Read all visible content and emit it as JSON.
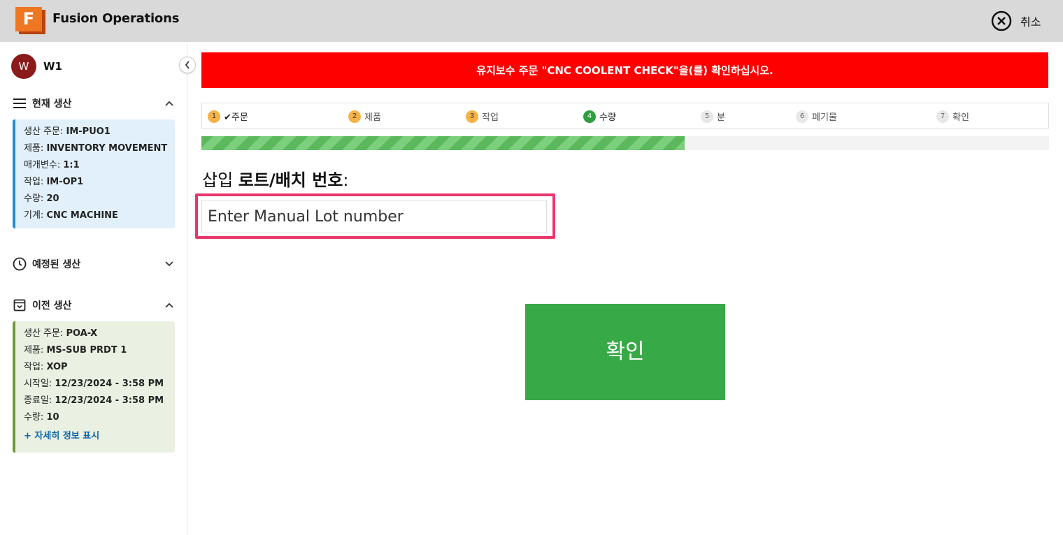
{
  "app": {
    "title": "Fusion Operations",
    "logo_letter": "F",
    "cancel_label": "취소"
  },
  "user": {
    "initial": "W",
    "name": "W1"
  },
  "sidebar": {
    "current": {
      "title": "현재 생산",
      "rows": [
        {
          "label": "생산 주문: ",
          "value": "IM-PUO1"
        },
        {
          "label": "제품: ",
          "value": "INVENTORY MOVEMENT"
        },
        {
          "label": "매개변수: ",
          "value": "1:1"
        },
        {
          "label": "작업: ",
          "value": "IM-OP1"
        },
        {
          "label": "수량: ",
          "value": "20"
        },
        {
          "label": "기계: ",
          "value": "CNC MACHINE"
        }
      ]
    },
    "scheduled": {
      "title": "예정된 생산"
    },
    "previous": {
      "title": "이전 생산",
      "rows": [
        {
          "label": "생산 주문: ",
          "value": "POA-X"
        },
        {
          "label": "제품: ",
          "value": "MS-SUB PRDT 1"
        },
        {
          "label": "작업: ",
          "value": "XOP"
        },
        {
          "label": "시작일: ",
          "value": "12/23/2024 - 3:58 PM"
        },
        {
          "label": "종료일: ",
          "value": "12/23/2024 - 3:58 PM"
        },
        {
          "label": "수량: ",
          "value": "10"
        }
      ],
      "more_link": "+ 자세히 정보 표시"
    }
  },
  "banner": "유지보수 주문 \"CNC COOLENT CHECK\"을(를) 확인하십시오.",
  "steps": [
    {
      "num": "1",
      "label": "✔주문",
      "state": "done"
    },
    {
      "num": "2",
      "label": "제품",
      "state": "done"
    },
    {
      "num": "3",
      "label": "작업",
      "state": "done"
    },
    {
      "num": "4",
      "label": "수량",
      "state": "active"
    },
    {
      "num": "5",
      "label": "분",
      "state": "todo"
    },
    {
      "num": "6",
      "label": "폐기물",
      "state": "todo"
    },
    {
      "num": "7",
      "label": "확인",
      "state": "todo"
    }
  ],
  "progress": 0.57,
  "prompt": {
    "prefix": "삽입 ",
    "strong": "로트/배치 번호",
    "suffix": ":"
  },
  "lot_input": {
    "placeholder": "Enter Manual Lot number",
    "value": ""
  },
  "confirm_label": "확인",
  "colors": {
    "banner": "#ff0000",
    "confirm": "#37a946",
    "highlight": "#e8386b",
    "step_done": "#f5b347",
    "step_active": "#2e9e3f"
  }
}
